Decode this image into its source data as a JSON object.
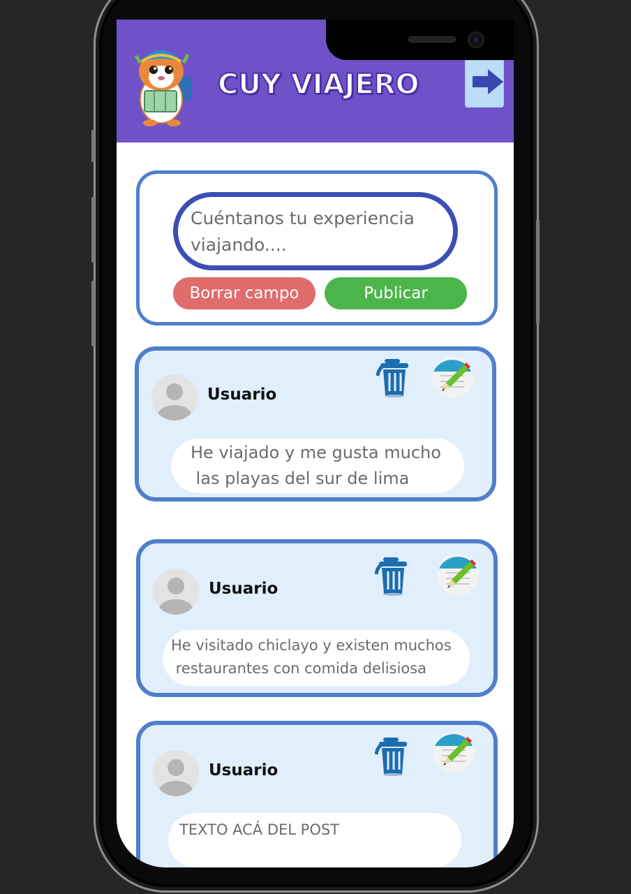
{
  "app": {
    "title": "CUY VIAJERO",
    "header_color": "#6f52c8"
  },
  "header": {
    "logo_icon": "guinea-pig-traveler-mascot",
    "logout_icon": "arrow-right-icon"
  },
  "composer": {
    "placeholder": "Cuéntanos tu experiencia viajando....",
    "clear_label": "Borrar campo",
    "publish_label": "Publicar"
  },
  "posts": [
    {
      "user": "Usuario",
      "text_line1": "He viajado y me gusta mucho",
      "text_line2": " las playas del sur de lima"
    },
    {
      "user": "Usuario",
      "text_line1": "He visitado chiclayo y existen muchos",
      "text_line2": " restaurantes con comida delisiosa"
    },
    {
      "user": "Usuario",
      "text_line1": "TEXTO ACÁ DEL POST",
      "text_line2": ""
    }
  ],
  "colors": {
    "card_border": "#4f7fcb",
    "card_bg": "#e1eefc",
    "clear_button": "#e06c6c",
    "publish_button": "#4bb54b",
    "input_border": "#3a4fb4"
  }
}
